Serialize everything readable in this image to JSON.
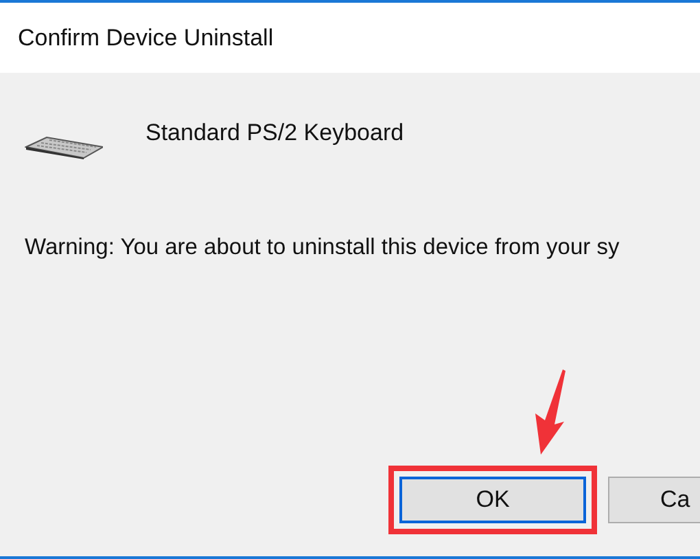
{
  "window": {
    "title": "Confirm Device Uninstall"
  },
  "device": {
    "name": "Standard PS/2 Keyboard"
  },
  "warning": "Warning: You are about to uninstall this device from your sy",
  "buttons": [
    {
      "label": "OK",
      "kind": "default",
      "highlighted": true,
      "pointed": true
    },
    {
      "label": "Ca",
      "kind": "normal",
      "highlighted": false,
      "pointed": false
    }
  ]
}
